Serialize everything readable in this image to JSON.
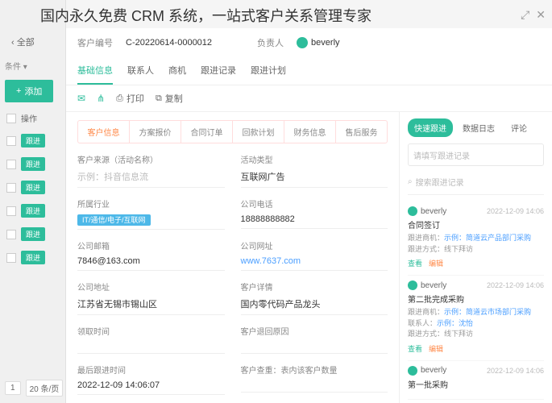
{
  "page_title": "国内永久免费 CRM 系统，一站式客户关系管理专家",
  "left": {
    "all": "全部",
    "filter": "条件",
    "add": "添加",
    "col_op": "操作",
    "row_btn": "跟进",
    "page_num": "1",
    "page_size": "20 条/页"
  },
  "header": {
    "id_label": "客户编号",
    "id_value": "C-20220614-0000012",
    "owner_label": "负责人",
    "owner_value": "beverly"
  },
  "main_tabs": [
    "基础信息",
    "联系人",
    "商机",
    "跟进记录",
    "跟进计划"
  ],
  "toolbar": {
    "print": "打印",
    "copy": "复制"
  },
  "sub_tabs": [
    "客户信息",
    "方案报价",
    "合同订单",
    "回款计划",
    "财务信息",
    "售后服务"
  ],
  "fields": {
    "source_label": "客户来源（活动名称）",
    "source_value": "示例：抖音信息流",
    "type_label": "活动类型",
    "type_value": "互联网广告",
    "industry_label": "所属行业",
    "industry_value": "IT/通信/电子/互联网",
    "phone_label": "公司电话",
    "phone_value": "18888888882",
    "email_label": "公司邮箱",
    "email_value": "7846@163.com",
    "url_label": "公司网址",
    "url_value": "www.7637.com",
    "addr_label": "公司地址",
    "addr_value": "江苏省无锡市锡山区",
    "detail_label": "客户详情",
    "detail_value": "国内零代码产品龙头",
    "recv_label": "领取时间",
    "recv_value": "",
    "return_label": "客户退回原因",
    "return_value": "",
    "last_label": "最后跟进时间",
    "last_value": "2022-12-09 14:06:07",
    "dup_label": "客户查重：表内该客户数量",
    "dup_value": ""
  },
  "side": {
    "tabs": [
      "快速跟进",
      "数据日志",
      "评论"
    ],
    "input_ph": "请填写跟进记录",
    "search_ph": "搜索跟进记录",
    "logs": [
      {
        "user": "beverly",
        "time": "2022-12-09 14:06",
        "title": "合同签订",
        "opp_label": "跟进商机：",
        "opp": "示例：简道云产品部门采购",
        "mode_label": "跟进方式：",
        "mode": "线下拜访",
        "view": "查看",
        "edit": "编辑"
      },
      {
        "user": "beverly",
        "time": "2022-12-09 14:06",
        "title": "第二批完成采购",
        "opp_label": "跟进商机：",
        "opp": "示例：简道云市场部门采购",
        "contact_label": "联系人：",
        "contact": "示例：沈怡",
        "mode_label": "跟进方式：",
        "mode": "线下拜访",
        "view": "查看",
        "edit": "编辑"
      },
      {
        "user": "beverly",
        "time": "2022-12-09 14:06",
        "title": "第一批采购"
      }
    ]
  }
}
